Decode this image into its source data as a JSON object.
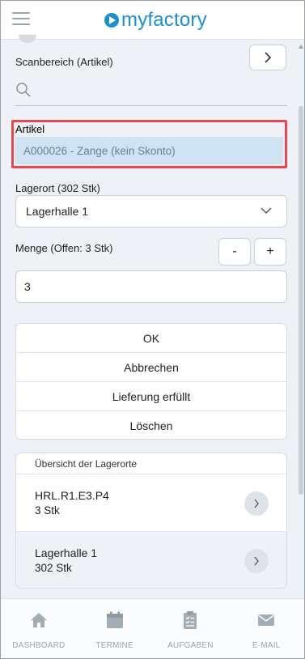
{
  "header": {
    "logo_text": "myfactory",
    "brand_color": "#1a8fd6"
  },
  "scan": {
    "label": "Scanbereich (Artikel)",
    "search_value": "",
    "search_placeholder": ""
  },
  "artikel": {
    "label": "Artikel",
    "value": "A000026 - Zange (kein Skonto)",
    "highlight_color": "#e8474c"
  },
  "lagerort": {
    "label": "Lagerort (302 Stk)",
    "selected": "Lagerhalle 1"
  },
  "menge": {
    "label": "Menge (Offen: 3 Stk)",
    "minus_label": "-",
    "plus_label": "+",
    "value": "3"
  },
  "actions": [
    {
      "label": "OK"
    },
    {
      "label": "Abbrechen"
    },
    {
      "label": "Lieferung erfüllt"
    },
    {
      "label": "Löschen"
    }
  ],
  "overview": {
    "title": "Übersicht der Lagerorte",
    "locations": [
      {
        "name": "HRL.R1.E3.P4",
        "qty": "3 Stk"
      },
      {
        "name": "Lagerhalle 1",
        "qty": "302 Stk"
      }
    ]
  },
  "bottom_nav": [
    {
      "label": "DASHBOARD",
      "icon": "home-icon"
    },
    {
      "label": "TERMINE",
      "icon": "calendar-icon"
    },
    {
      "label": "AUFGABEN",
      "icon": "clipboard-icon"
    },
    {
      "label": "E-MAIL",
      "icon": "mail-icon"
    }
  ]
}
